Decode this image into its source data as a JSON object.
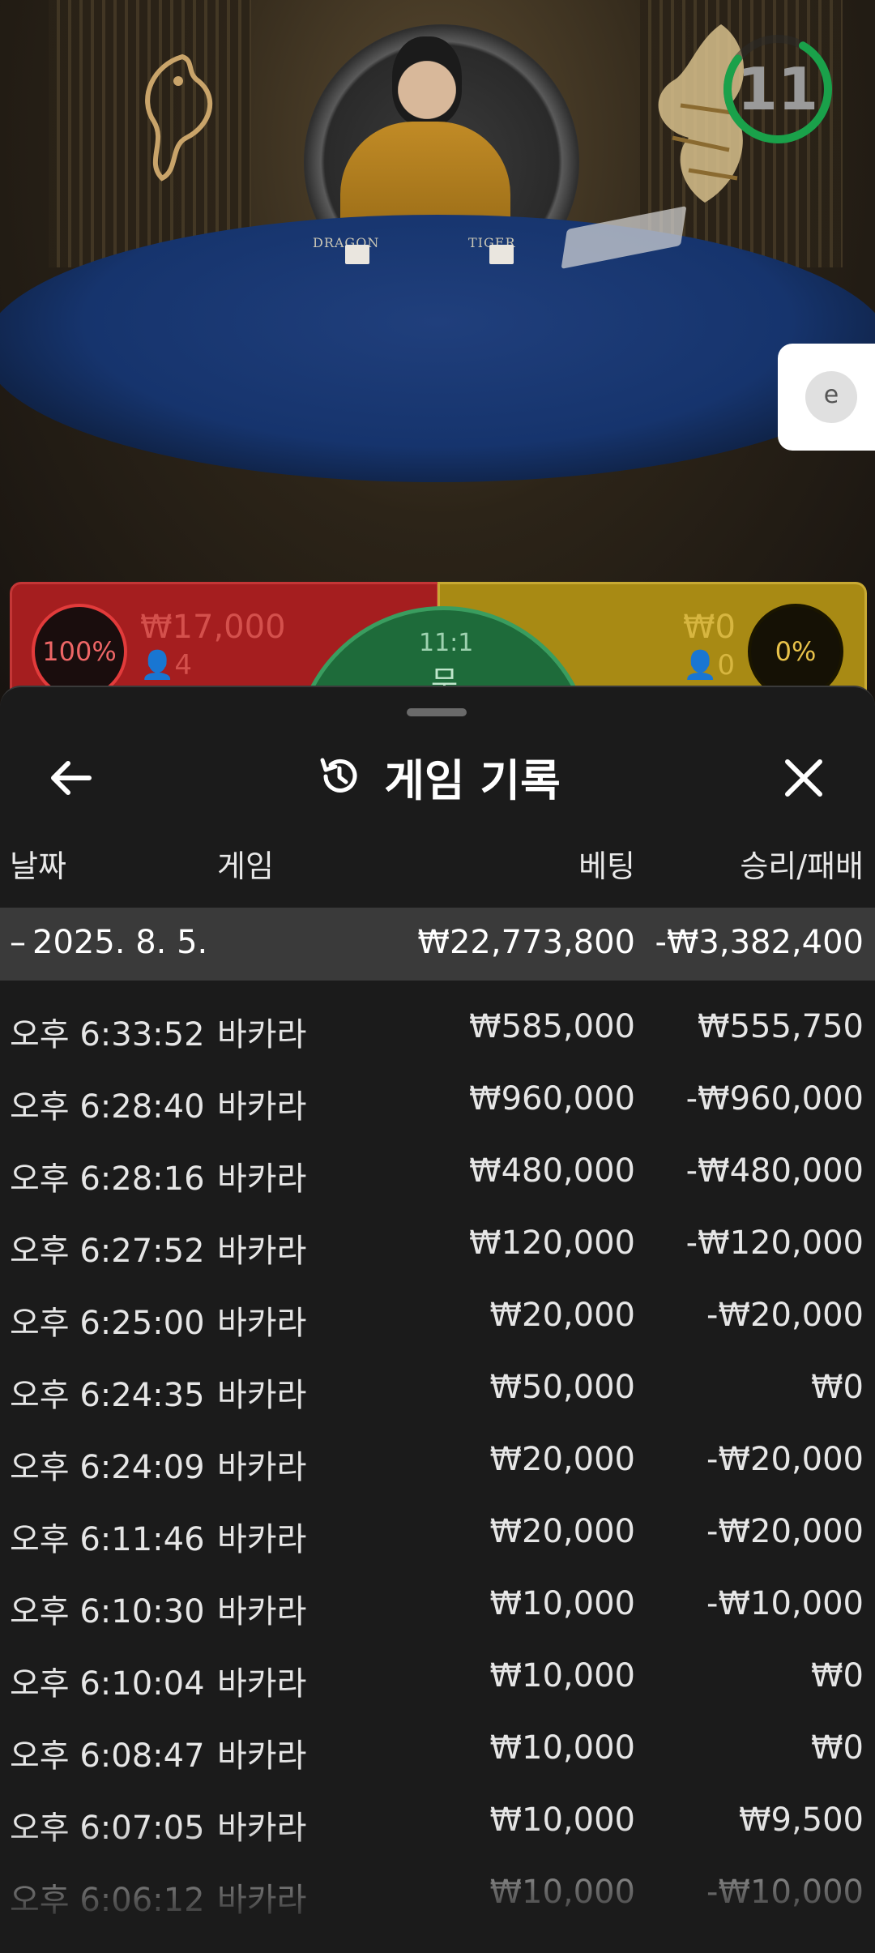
{
  "game_view": {
    "table_labels": {
      "dragon": "DRAGON",
      "tiger": "TIGER"
    },
    "countdown": "11",
    "side_tab_letter": "e"
  },
  "bet_strip": {
    "dragon": {
      "percent": "100%",
      "amount": "₩17,000",
      "players": "4"
    },
    "tiger": {
      "percent": "0%",
      "amount": "₩0",
      "players": "0"
    },
    "tie": {
      "odds": "11:1",
      "label": "무"
    }
  },
  "history": {
    "title": "게임 기록",
    "columns": {
      "date": "날짜",
      "game": "게임",
      "bet": "베팅",
      "result": "승리/패배"
    },
    "summary": {
      "date": "2025. 8. 5.",
      "total_bet": "₩22,773,800",
      "total_result": "-₩3,382,400"
    },
    "rows": [
      {
        "time": "오후 6:33:52",
        "game": "바카라",
        "bet": "₩585,000",
        "result": "₩555,750"
      },
      {
        "time": "오후 6:28:40",
        "game": "바카라",
        "bet": "₩960,000",
        "result": "-₩960,000"
      },
      {
        "time": "오후 6:28:16",
        "game": "바카라",
        "bet": "₩480,000",
        "result": "-₩480,000"
      },
      {
        "time": "오후 6:27:52",
        "game": "바카라",
        "bet": "₩120,000",
        "result": "-₩120,000"
      },
      {
        "time": "오후 6:25:00",
        "game": "바카라",
        "bet": "₩20,000",
        "result": "-₩20,000"
      },
      {
        "time": "오후 6:24:35",
        "game": "바카라",
        "bet": "₩50,000",
        "result": "₩0"
      },
      {
        "time": "오후 6:24:09",
        "game": "바카라",
        "bet": "₩20,000",
        "result": "-₩20,000"
      },
      {
        "time": "오후 6:11:46",
        "game": "바카라",
        "bet": "₩20,000",
        "result": "-₩20,000"
      },
      {
        "time": "오후 6:10:30",
        "game": "바카라",
        "bet": "₩10,000",
        "result": "-₩10,000"
      },
      {
        "time": "오후 6:10:04",
        "game": "바카라",
        "bet": "₩10,000",
        "result": "₩0"
      },
      {
        "time": "오후 6:08:47",
        "game": "바카라",
        "bet": "₩10,000",
        "result": "₩0"
      },
      {
        "time": "오후 6:07:05",
        "game": "바카라",
        "bet": "₩10,000",
        "result": "₩9,500"
      },
      {
        "time": "오후 6:06:12",
        "game": "바카라",
        "bet": "₩10,000",
        "result": "-₩10,000"
      }
    ]
  },
  "colors": {
    "sheet_bg": "#1b1b1b",
    "summary_bg": "#3a3a3a",
    "dragon_red": "#a51e1f",
    "tiger_gold": "#a88a14",
    "tie_green": "#1e6b3a",
    "timer_green": "#1aa14a"
  }
}
